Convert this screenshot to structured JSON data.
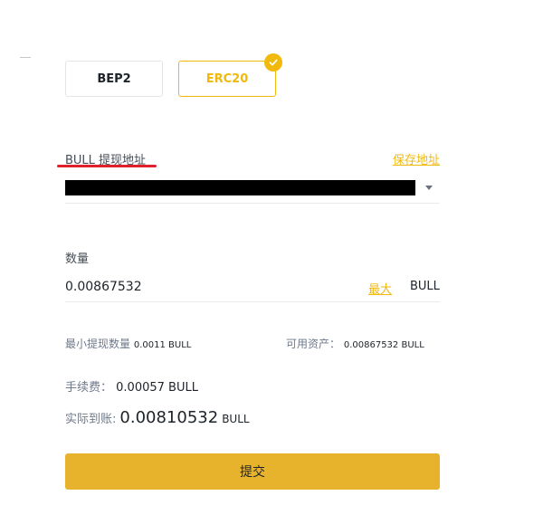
{
  "network": {
    "options": [
      {
        "label": "BEP2",
        "selected": false
      },
      {
        "label": "ERC20",
        "selected": true
      }
    ]
  },
  "address": {
    "label": "BULL 提现地址",
    "save_link": "保存地址"
  },
  "quantity": {
    "label": "数量",
    "value": "0.00867532",
    "max_link": "最大",
    "unit": "BULL"
  },
  "limits": {
    "min_label": "最小提现数量",
    "min_value": "0.0011 BULL",
    "available_label": "可用资产：",
    "available_value": "0.00867532 BULL"
  },
  "fee": {
    "label": "手续费：",
    "value": "0.00057 BULL"
  },
  "received": {
    "label": "实际到账:",
    "amount": "0.00810532",
    "unit": "BULL"
  },
  "submit_label": "提交",
  "colors": {
    "accent": "#f0b90b",
    "button": "#e8b32c",
    "highlight_underline": "#e0202a"
  }
}
